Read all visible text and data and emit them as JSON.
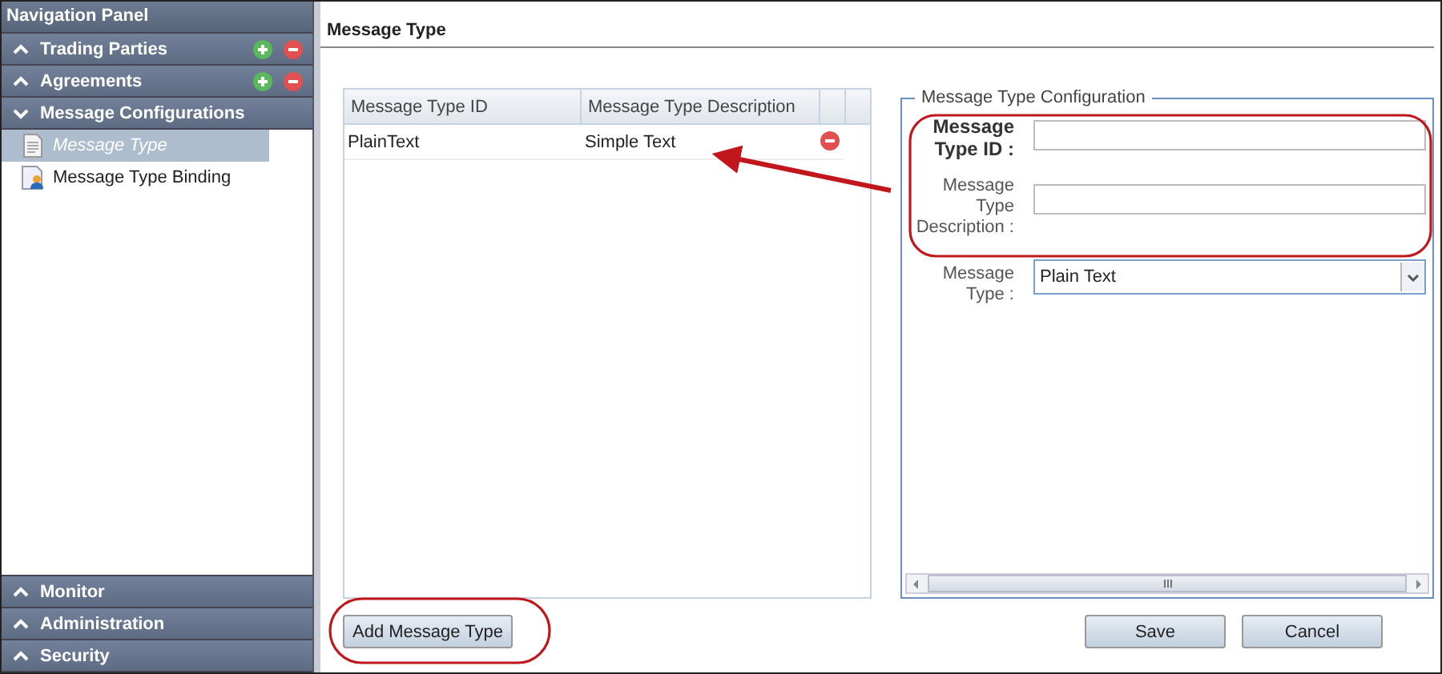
{
  "nav": {
    "title": "Navigation Panel",
    "sections": [
      {
        "label": "Trading Parties",
        "expanded": false,
        "editable": true
      },
      {
        "label": "Agreements",
        "expanded": false,
        "editable": true
      },
      {
        "label": "Message Configurations",
        "expanded": true,
        "editable": false,
        "items": [
          {
            "label": "Message Type",
            "selected": true,
            "kind": "document"
          },
          {
            "label": "Message Type Binding",
            "selected": false,
            "kind": "binding"
          }
        ]
      }
    ],
    "bottom_sections": [
      {
        "label": "Monitor",
        "expanded": false
      },
      {
        "label": "Administration",
        "expanded": false
      },
      {
        "label": "Security",
        "expanded": false
      }
    ]
  },
  "page": {
    "title": "Message Type",
    "table": {
      "columns": [
        "Message Type ID",
        "Message Type Description"
      ],
      "rows": [
        {
          "id": "PlainText",
          "description": "Simple Text"
        }
      ]
    },
    "add_button": "Add Message Type",
    "config": {
      "legend": "Message Type Configuration",
      "fields": [
        {
          "label": "Message Type ID :",
          "kind": "text",
          "required": true
        },
        {
          "label": "Message Type Description :",
          "kind": "text",
          "required": false
        },
        {
          "label": "Message Type :",
          "kind": "select",
          "required": false,
          "value": "Plain Text"
        }
      ]
    },
    "buttons": [
      "Save",
      "Cancel"
    ]
  }
}
